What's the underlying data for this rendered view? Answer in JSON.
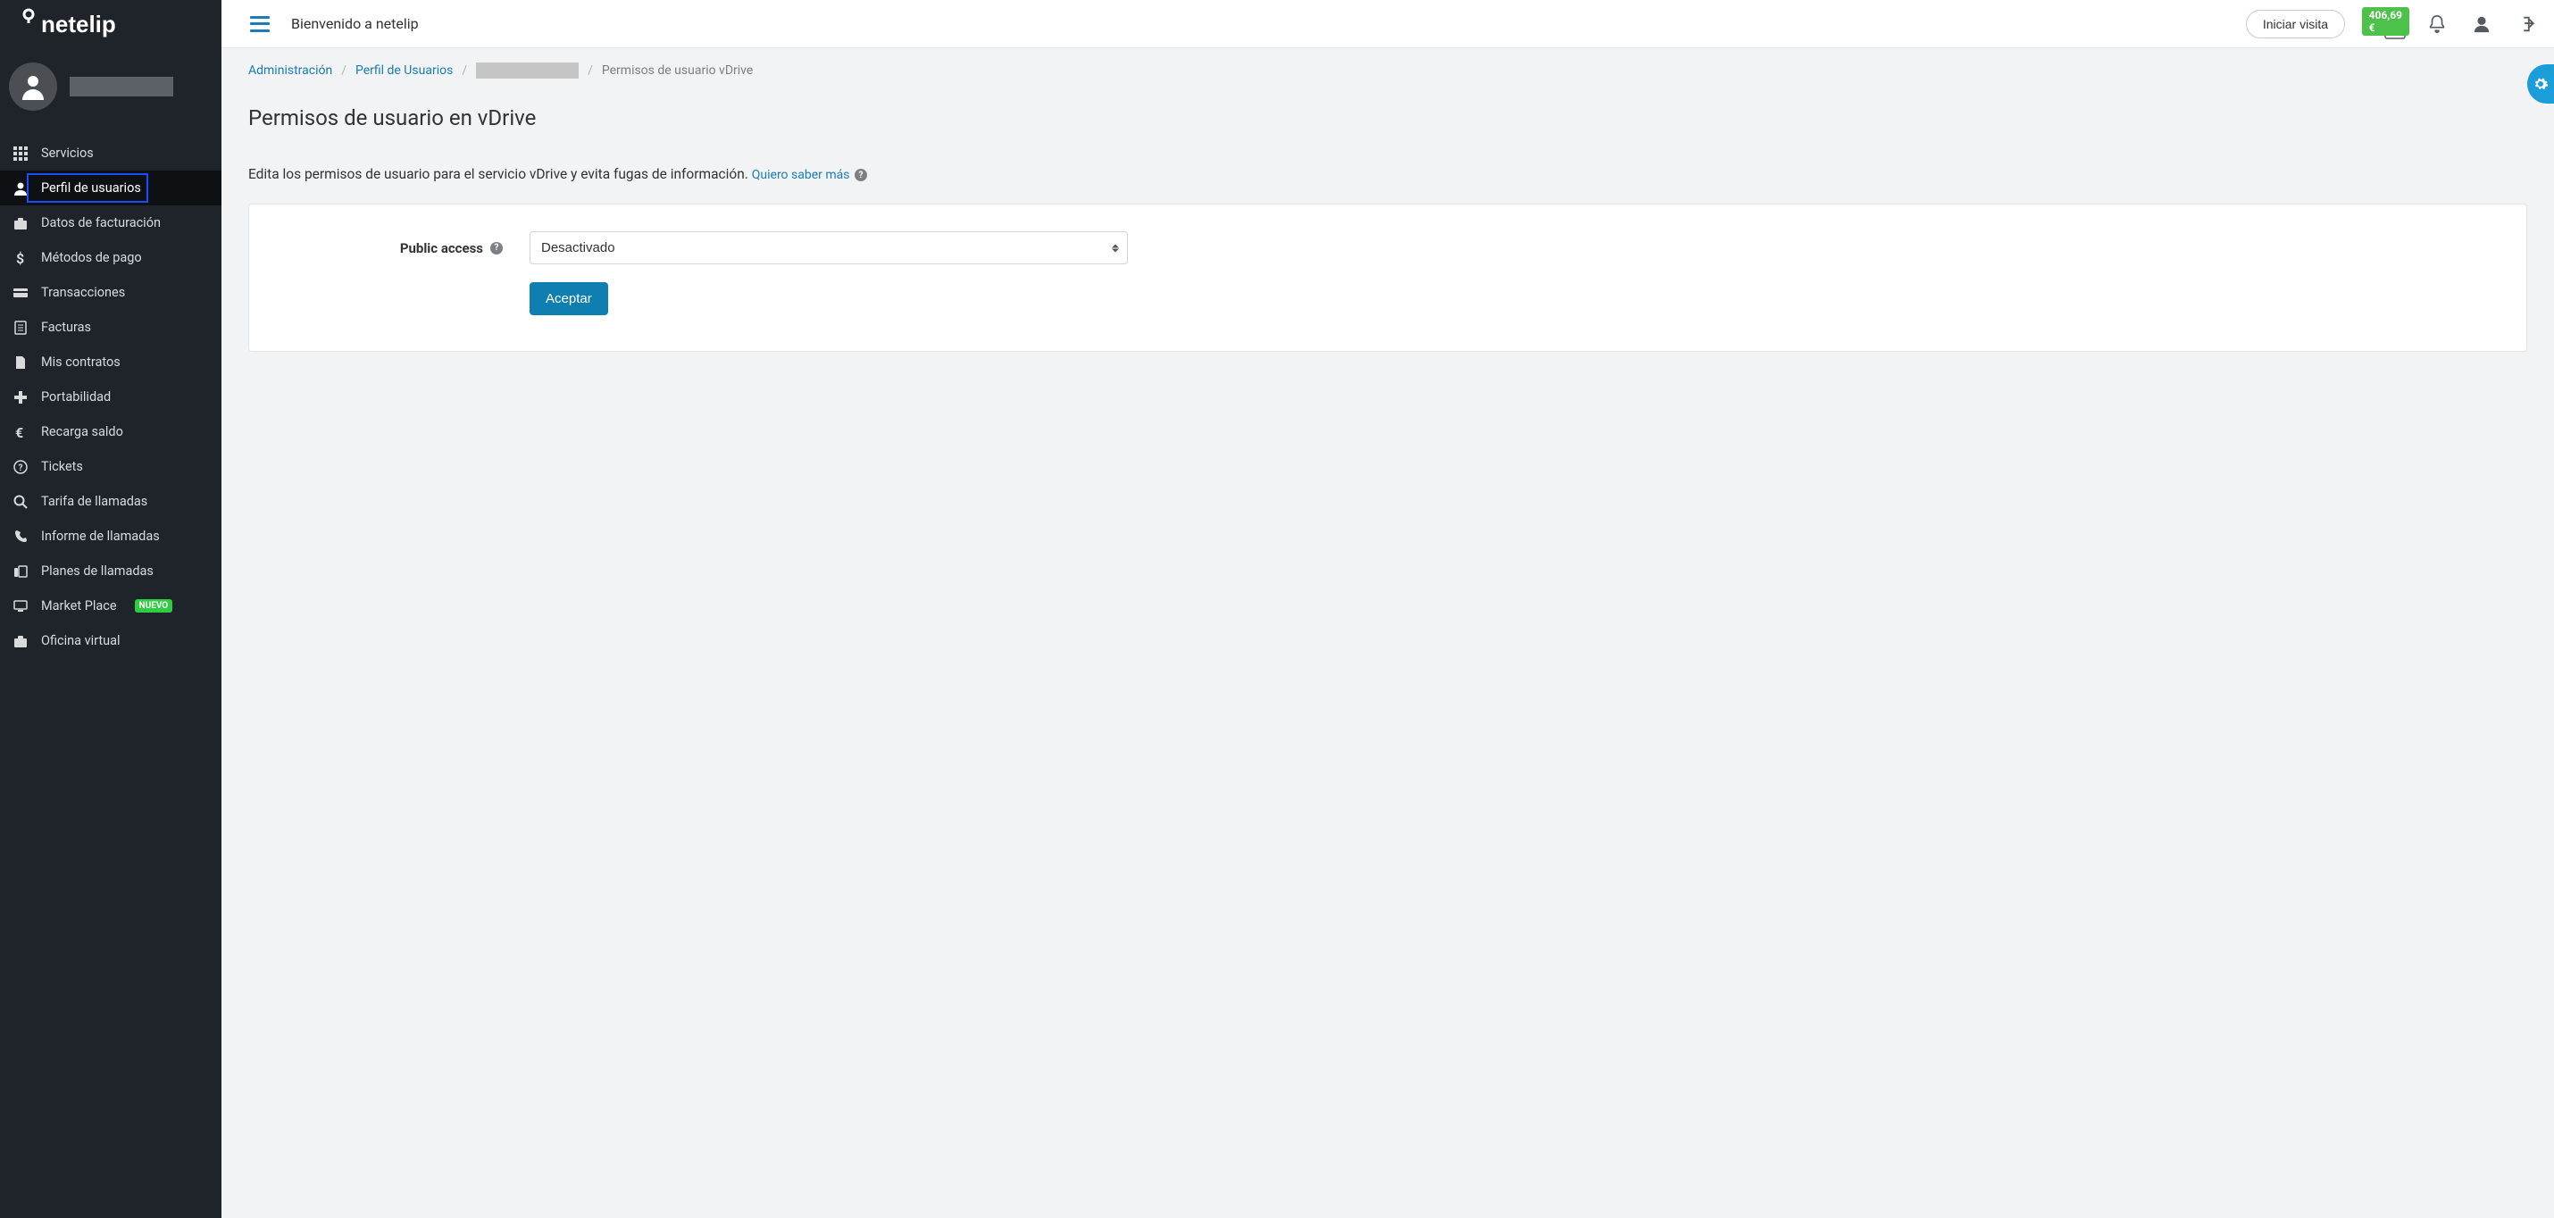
{
  "brand": "netelip",
  "header": {
    "welcome": "Bienvenido a netelip",
    "visit_button": "Iniciar visita",
    "balance": "406,69 €"
  },
  "sidebar": {
    "items": [
      {
        "label": "Servicios",
        "icon": "grid"
      },
      {
        "label": "Perfil de usuarios",
        "icon": "user",
        "active": true
      },
      {
        "label": "Datos de facturación",
        "icon": "briefcase"
      },
      {
        "label": "Métodos de pago",
        "icon": "dollar"
      },
      {
        "label": "Transacciones",
        "icon": "card"
      },
      {
        "label": "Facturas",
        "icon": "doc"
      },
      {
        "label": "Mis contratos",
        "icon": "file"
      },
      {
        "label": "Portabilidad",
        "icon": "plus"
      },
      {
        "label": "Recarga saldo",
        "icon": "euro"
      },
      {
        "label": "Tickets",
        "icon": "question"
      },
      {
        "label": "Tarifa de llamadas",
        "icon": "search"
      },
      {
        "label": "Informe de llamadas",
        "icon": "phone"
      },
      {
        "label": "Planes de llamadas",
        "icon": "phone-office"
      },
      {
        "label": "Market Place",
        "icon": "monitor",
        "badge": "NUEVO"
      },
      {
        "label": "Oficina virtual",
        "icon": "briefcase"
      }
    ]
  },
  "breadcrumb": {
    "items": [
      {
        "label": "Administración",
        "link": true
      },
      {
        "label": "Perfil de Usuarios",
        "link": true
      },
      {
        "redacted": true
      },
      {
        "label": "Permisos de usuario vDrive",
        "current": true
      }
    ]
  },
  "page": {
    "title": "Permisos de usuario en vDrive",
    "intro": "Edita los permisos de usuario para el servicio vDrive y evita fugas de información.",
    "intro_link": "Quiero saber más"
  },
  "form": {
    "public_access_label": "Public access",
    "public_access_value": "Desactivado",
    "submit": "Aceptar"
  }
}
